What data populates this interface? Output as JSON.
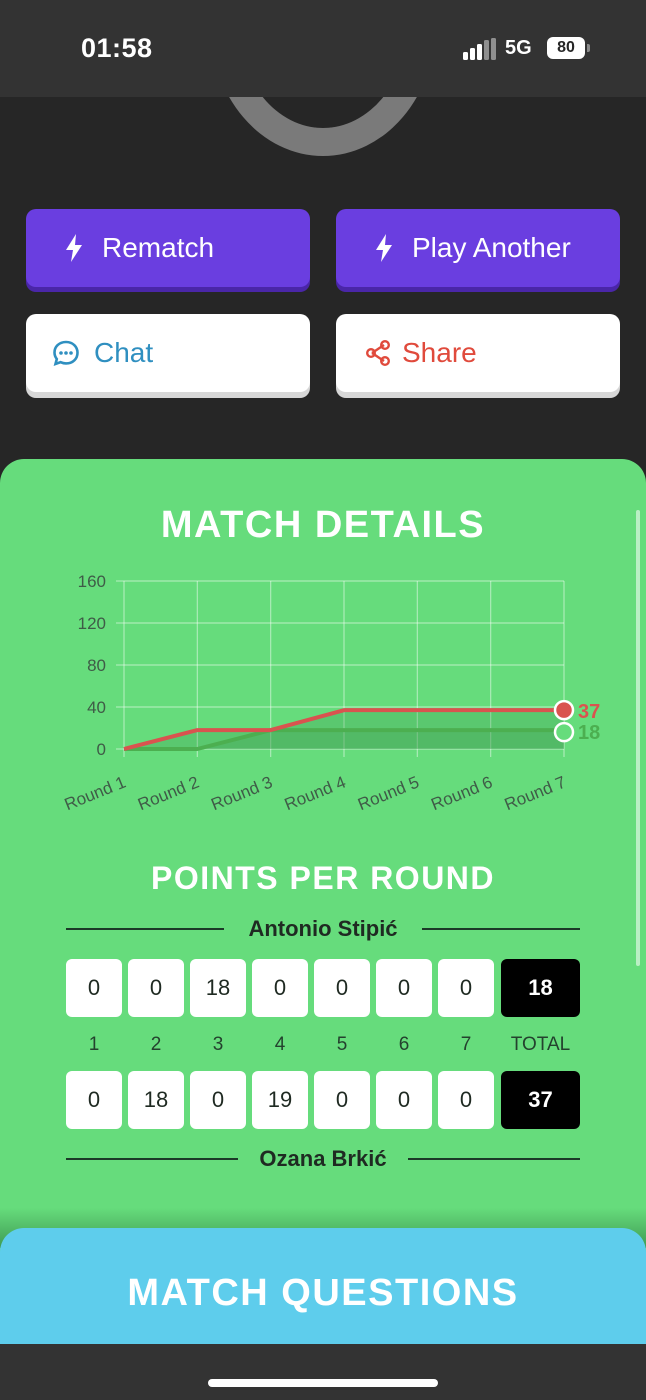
{
  "status_bar": {
    "time": "01:58",
    "network": "5G",
    "battery": "80"
  },
  "actions": {
    "rematch": "Rematch",
    "play_another": "Play Another",
    "chat": "Chat",
    "share": "Share"
  },
  "colors": {
    "primary": "#6a3ee0",
    "panel": "#66dc7c",
    "chat": "#2f8fc0",
    "share": "#e04a3c",
    "series_red": "#d9534f",
    "series_green": "#4caf50",
    "questions": "#5ecdec"
  },
  "match_details": {
    "title": "MATCH DETAILS",
    "chart_data": {
      "type": "line",
      "categories": [
        "Round 1",
        "Round 2",
        "Round 3",
        "Round 4",
        "Round 5",
        "Round 6",
        "Round 7"
      ],
      "y_ticks": [
        "160",
        "120",
        "80",
        "40",
        "0"
      ],
      "ylim": [
        0,
        160
      ],
      "grid": true,
      "series": [
        {
          "values": [
            0,
            18,
            18,
            37,
            37,
            37,
            37
          ],
          "end_label": "37",
          "color": "#d9534f"
        },
        {
          "values": [
            0,
            0,
            18,
            18,
            18,
            18,
            18
          ],
          "end_label": "18",
          "color": "#4caf50"
        }
      ]
    }
  },
  "points_per_round": {
    "title": "POINTS PER ROUND",
    "player_top": {
      "name": "Antonio Stipić",
      "scores": [
        "0",
        "0",
        "18",
        "0",
        "0",
        "0",
        "0"
      ],
      "total": "18"
    },
    "round_labels": [
      "1",
      "2",
      "3",
      "4",
      "5",
      "6",
      "7"
    ],
    "total_label": "TOTAL",
    "player_bottom": {
      "name": "Ozana Brkić",
      "scores": [
        "0",
        "18",
        "0",
        "19",
        "0",
        "0",
        "0"
      ],
      "total": "37"
    }
  },
  "match_questions": {
    "title": "MATCH QUESTIONS"
  }
}
